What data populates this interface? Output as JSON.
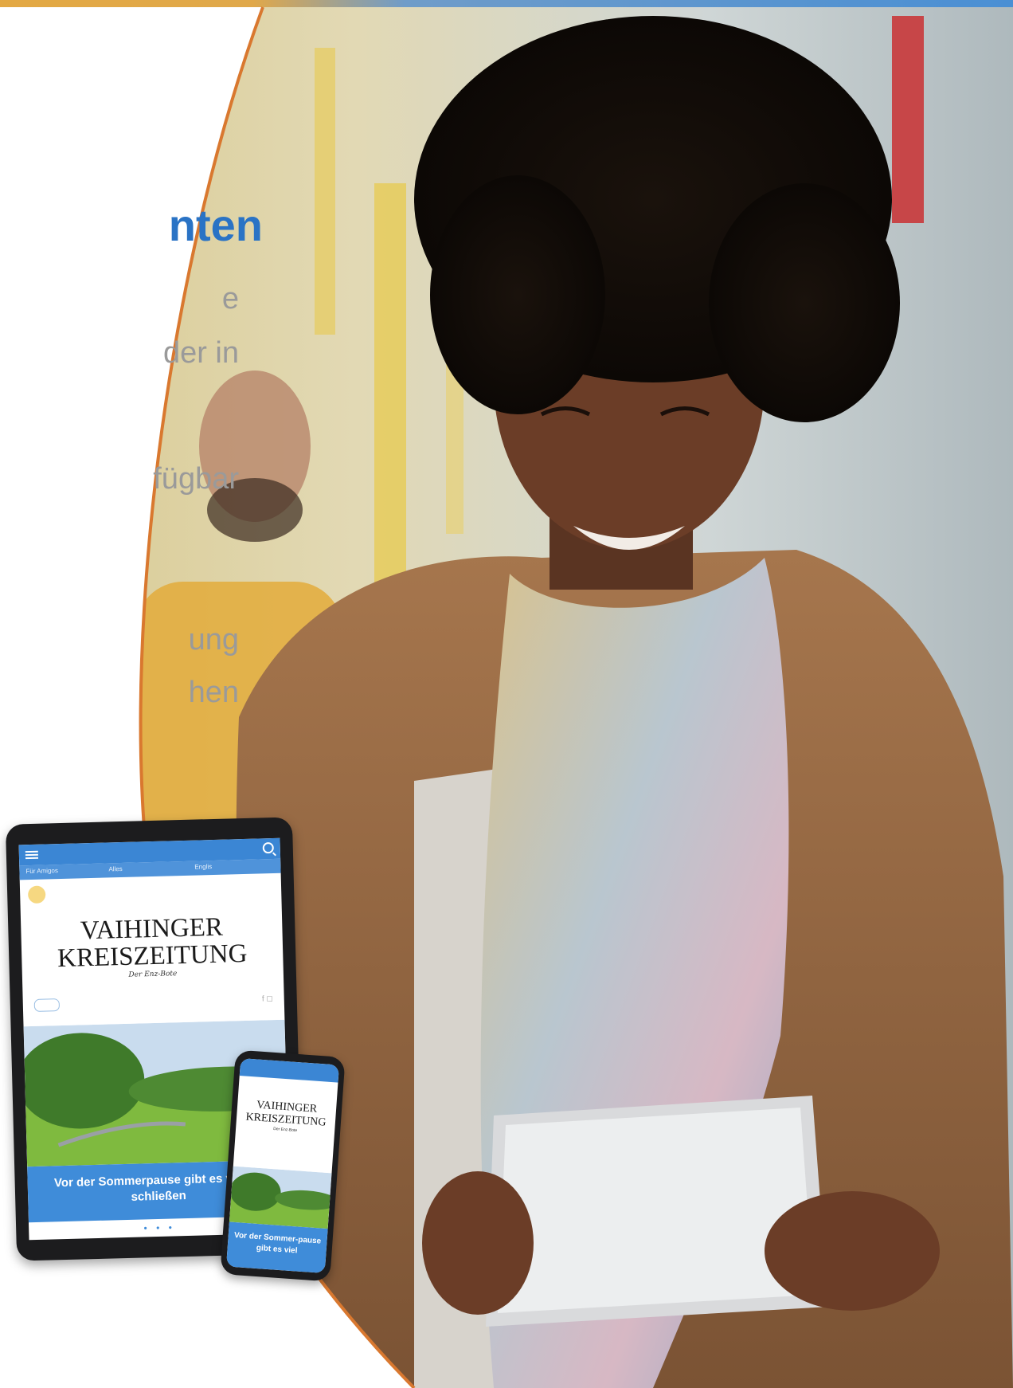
{
  "headline": "nten",
  "body_lines": [
    "e",
    "der in",
    "fügbar",
    "ung",
    "hen"
  ],
  "tablet": {
    "nav": [
      "Für Amigos",
      "Alles",
      "Englis"
    ],
    "logo_line1": "VAIHINGER",
    "logo_line2": "KREISZEITUNG",
    "logo_subline": "Der Enz-Bote",
    "caption": "Vor der Sommerpause gibt es viel zu schließen",
    "dots": "• • •"
  },
  "phone": {
    "logo_line1": "VAIHINGER",
    "logo_line2": "KREISZEITUNG",
    "logo_subline": "Der Enz-Bote",
    "caption": "Vor der Sommer-pause gibt es viel"
  },
  "colors": {
    "accent_blue": "#2a73c5",
    "arc_orange": "#d9782f",
    "caption_blue": "#3f8cd9",
    "body_gray": "#9a9a9a"
  }
}
